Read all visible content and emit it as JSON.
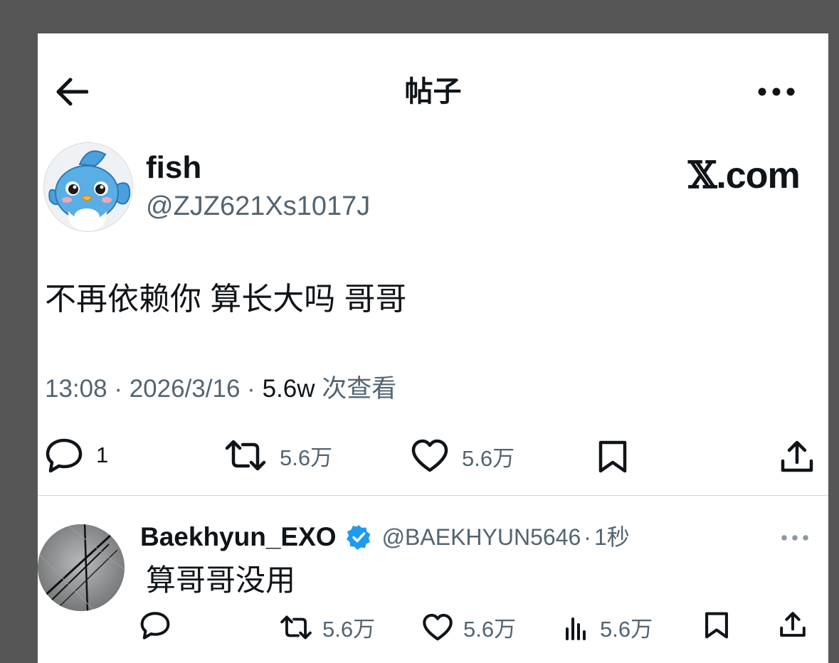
{
  "header": {
    "title": "帖子"
  },
  "author": {
    "name": "fish",
    "handle": "@ZJZ621Xs1017J"
  },
  "brand": {
    "x_glyph": "𝕏",
    "suffix": ".com"
  },
  "post": {
    "text": "不再依赖你 算长大吗 哥哥"
  },
  "meta": {
    "time": "13:08",
    "date": "2026/3/16",
    "views_count": "5.6w",
    "views_label": "次查看",
    "separator": "·"
  },
  "actions": {
    "replies": "1",
    "reposts": "5.6万",
    "likes": "5.6万"
  },
  "reply": {
    "name": "Baekhyun_EXO",
    "handle": "@BAEKHYUN5646",
    "time": "1秒",
    "separator": "·",
    "text": "算哥哥没用",
    "reposts": "5.6万",
    "likes": "5.6万",
    "views": "5.6万"
  },
  "colors": {
    "text": "#0f1419",
    "secondary": "#536471",
    "verified": "#1d9bf0",
    "divider": "#cfd9de"
  }
}
